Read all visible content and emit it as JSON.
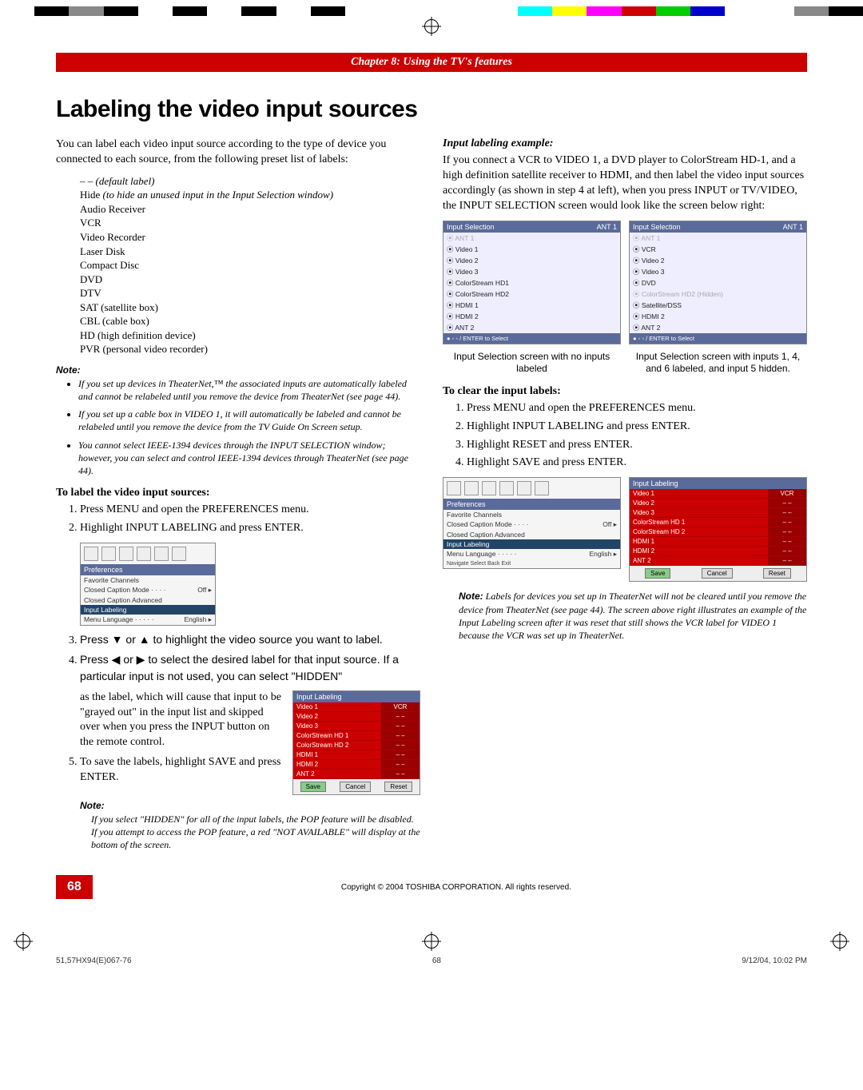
{
  "chapter_bar": "Chapter 8: Using the TV's features",
  "heading": "Labeling the video input sources",
  "left": {
    "intro": "You can label each video input source according to the type of device you connected to each source, from the following preset list of labels:",
    "labels": [
      {
        "t": "– –",
        "paren": "(default label)"
      },
      {
        "t": "Hide",
        "paren": "(to hide an unused input in the Input Selection window)"
      },
      {
        "t": "Audio Receiver"
      },
      {
        "t": "VCR"
      },
      {
        "t": "Video Recorder"
      },
      {
        "t": "Laser Disk"
      },
      {
        "t": "Compact Disc"
      },
      {
        "t": "DVD"
      },
      {
        "t": "DTV"
      },
      {
        "t": "SAT (satellite box)"
      },
      {
        "t": "CBL (cable box)"
      },
      {
        "t": "HD (high definition device)"
      },
      {
        "t": "PVR (personal video recorder)"
      }
    ],
    "note_hd": "Note:",
    "note_items": [
      "If you set up devices in TheaterNet,™ the associated inputs are automatically labeled and cannot be relabeled until you remove the device from TheaterNet (see page 44).",
      "If you set up a cable box in VIDEO 1, it will automatically be labeled and cannot be relabeled until you remove the device from the TV Guide On Screen setup.",
      "You cannot select IEEE-1394 devices through the INPUT SELECTION window; however, you can select and control IEEE-1394 devices through TheaterNet (see page 44)."
    ],
    "sub_label": "To label the video input sources:",
    "steps12": [
      "Press MENU and open the PREFERENCES menu.",
      "Highlight INPUT LABELING and press ENTER."
    ],
    "menu": {
      "title": "Preferences",
      "rows": [
        {
          "l": "Favorite Channels",
          "r": ""
        },
        {
          "l": "Closed Caption Mode · · · ·",
          "r": "Off  ▸"
        },
        {
          "l": "Closed Caption Advanced",
          "r": ""
        },
        {
          "l": "Input Labeling",
          "r": "",
          "hl": true
        },
        {
          "l": "Menu Language · · · · ·",
          "r": "English  ▸"
        }
      ]
    },
    "step3": "Press ▼ or ▲ to highlight the video source you want to label.",
    "step4a": "Press ◀ or ▶ to select the desired label for that input source. If a particular input is not used, you can select \"HIDDEN\"",
    "step4b": "as the label, which will cause that input to be \"grayed out\" in the input list and skipped over when you press the INPUT button on the remote control.",
    "step5": "To save the labels, highlight SAVE and press ENTER.",
    "input_labeling_box": {
      "title": "Input Labeling",
      "rows": [
        [
          "Video 1",
          "VCR"
        ],
        [
          "Video 2",
          "– –"
        ],
        [
          "Video 3",
          "– –"
        ],
        [
          "ColorStream HD 1",
          "– –"
        ],
        [
          "ColorStream HD 2",
          "– –"
        ],
        [
          "HDMI 1",
          "– –"
        ],
        [
          "HDMI 2",
          "– –"
        ],
        [
          "ANT 2",
          "– –"
        ]
      ],
      "btns": [
        "Save",
        "Cancel",
        "Reset"
      ]
    },
    "note2_hd": "Note:",
    "note2_body": "If you select \"HIDDEN\" for all of the input labels, the POP feature will be disabled. If you attempt to access the POP feature, a red \"NOT AVAILABLE\" will display at the bottom of the screen."
  },
  "right": {
    "sub_example": "Input labeling example:",
    "example_body": "If you connect a VCR to VIDEO 1, a DVD player to ColorStream HD-1, and a high definition satellite receiver to HDMI, and then label the video input sources accordingly (as shown in step 4 at left), when you press INPUT or TV/VIDEO, the INPUT SELECTION screen would look like the screen below right:",
    "sel_left": {
      "title": "Input Selection",
      "badge": "ANT 1",
      "rows": [
        {
          "t": "ANT 1",
          "dim": true
        },
        {
          "t": "Video 1"
        },
        {
          "t": "Video 2"
        },
        {
          "t": "Video 3"
        },
        {
          "t": "ColorStream HD1"
        },
        {
          "t": "ColorStream HD2"
        },
        {
          "t": "HDMI 1"
        },
        {
          "t": "HDMI 2"
        },
        {
          "t": "ANT 2"
        }
      ],
      "foot": "● ◦ ◦ / ENTER to Select"
    },
    "sel_right": {
      "title": "Input Selection",
      "badge": "ANT 1",
      "rows": [
        {
          "t": "ANT 1",
          "dim": true
        },
        {
          "t": "VCR"
        },
        {
          "t": "Video 2"
        },
        {
          "t": "Video 3"
        },
        {
          "t": "DVD"
        },
        {
          "t": "ColorStream HD2 (Hidden)",
          "dim": true
        },
        {
          "t": "Satellite/DSS"
        },
        {
          "t": "HDMI 2"
        },
        {
          "t": "ANT 2"
        }
      ],
      "foot": "● ◦ ◦ / ENTER to Select"
    },
    "cap_left": "Input Selection screen with no inputs labeled",
    "cap_right": "Input Selection screen with inputs 1, 4, and 6 labeled, and input 5 hidden.",
    "sub_clear": "To clear the input labels:",
    "clear_steps": [
      "Press MENU and open the PREFERENCES menu.",
      "Highlight INPUT LABELING and press ENTER.",
      "Highlight RESET and press ENTER.",
      "Highlight SAVE and press ENTER."
    ],
    "menu2": {
      "title": "Preferences",
      "rows": [
        {
          "l": "Favorite Channels",
          "r": ""
        },
        {
          "l": "Closed Caption Mode · · · ·",
          "r": "Off  ▸"
        },
        {
          "l": "Closed Caption Advanced",
          "r": ""
        },
        {
          "l": "Input Labeling",
          "r": "",
          "hl": true
        },
        {
          "l": "Menu Language · · · · ·",
          "r": "English  ▸"
        }
      ],
      "foot": "Navigate   Select   Back   Exit"
    },
    "ilb2": {
      "title": "Input Labeling",
      "rows": [
        [
          "Video 1",
          "VCR"
        ],
        [
          "Video 2",
          "– –"
        ],
        [
          "Video 3",
          "– –"
        ],
        [
          "ColorStream HD 1",
          "– –"
        ],
        [
          "ColorStream HD 2",
          "– –"
        ],
        [
          "HDMI 1",
          "– –"
        ],
        [
          "HDMI 2",
          "– –"
        ],
        [
          "ANT 2",
          "– –"
        ]
      ],
      "btns": [
        "Save",
        "Cancel",
        "Reset"
      ]
    },
    "note3": "Labels for devices you set up in TheaterNet will not be cleared until you remove the device from TheaterNet (see page 44). The screen above right illustrates an example of the Input Labeling screen after it was reset that still shows the VCR label for VIDEO 1 because the VCR was set up in TheaterNet.",
    "note3_lead": "Note:"
  },
  "page_num": "68",
  "copyright": "Copyright © 2004 TOSHIBA CORPORATION. All rights reserved.",
  "file_left": "51,57HX94(E)067-76",
  "file_mid": "68",
  "file_right": "9/12/04, 10:02 PM",
  "colors": [
    "#fff",
    "#000",
    "#888",
    "#000",
    "#fff",
    "#000",
    "#fff",
    "#000",
    "#fff",
    "#000",
    "#fff",
    "#fff",
    "#fff",
    "#fff",
    "#fff",
    "#0ff",
    "#f0f",
    "#ff0",
    "#c00",
    "#0c0",
    "#00c",
    "#fff",
    "#fff",
    "#888",
    "#000"
  ]
}
